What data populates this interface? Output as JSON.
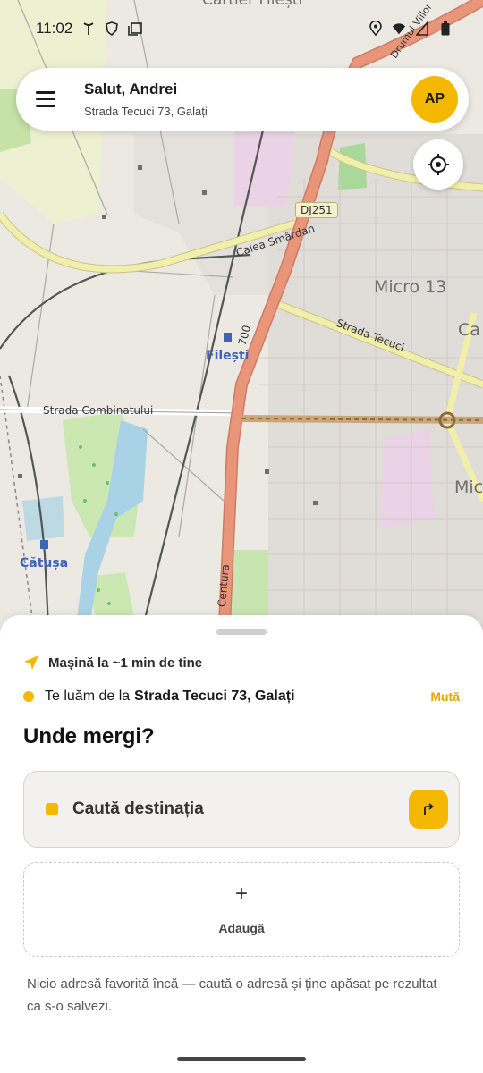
{
  "status_bar": {
    "time": "11:02"
  },
  "header": {
    "greeting": "Salut, Andrei",
    "address": "Strada Tecuci 73, Galați",
    "avatar_initials": "AP"
  },
  "map": {
    "labels": {
      "cartier": "Cartier Filești",
      "micro13": "Micro 13",
      "ca": "Ca",
      "mic": "Mic",
      "dj251": "DJ251",
      "calea_smardan": "Calea Smârdan",
      "strada_tecuci": "Strada Tecuci",
      "filesti": "Filești",
      "road_700": "700",
      "strada_combinatului": "Strada Combinatului",
      "catusa": "Cătușa",
      "centura": "Centura",
      "drumul_viilor": "Drumul Viilor"
    }
  },
  "sheet": {
    "eta": "Mașină la ~1 min de tine",
    "pickup_prefix": "Te luăm de la",
    "pickup_address": "Strada Tecuci 73, Galați",
    "move_label": "Mută",
    "question": "Unde mergi?",
    "search_placeholder": "Caută destinația",
    "add_label": "Adaugă",
    "add_symbol": "+",
    "hint": "Nicio adresă favorită încă — caută o adresă și ține apăsat pe rezultat ca s-o salvezi."
  },
  "colors": {
    "accent": "#f5b800",
    "map_background": "#e9e6df",
    "main_road": "#e8957a",
    "secondary_road": "#f1efa9",
    "greenery": "#cde8b4"
  }
}
